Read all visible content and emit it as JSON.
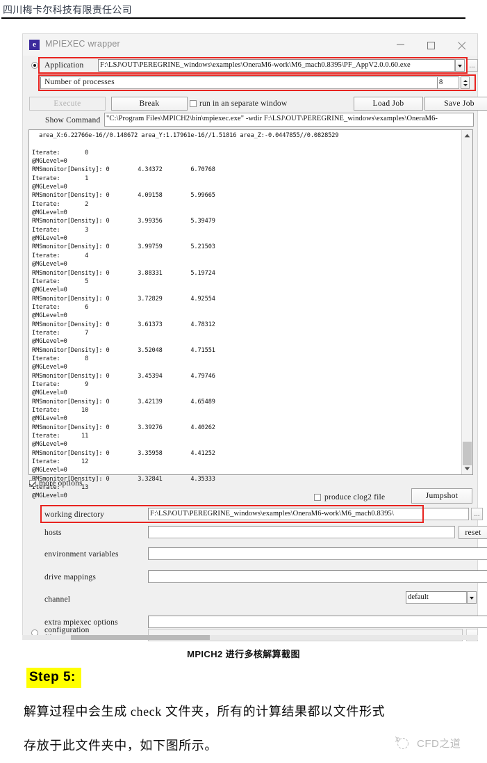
{
  "document": {
    "header_company": "四川梅卡尔科技有限责任公司",
    "caption": "MPICH2 进行多核解算截图",
    "step_badge": "Step 5:",
    "paragraph_line1": "解算过程中会生成 check 文件夹，所有的计算结果都以文件形式",
    "paragraph_line2": "存放于此文件夹中，如下图所示。",
    "watermark_text": "CFD之道"
  },
  "window": {
    "title": "MPIEXEC wrapper",
    "app_icon_glyph": "e",
    "minimize_label": "minimize",
    "maximize_label": "maximize",
    "close_label": "close"
  },
  "application_row": {
    "label": "Application",
    "value": "F:\\LSJ\\OUT\\PEREGRINE_windows\\examples\\OneraM6-work\\M6_mach0.8395\\PF_AppV2.0.0.60.exe",
    "browse_label": "...",
    "radio_selected": true
  },
  "processes_row": {
    "label": "Number of processes",
    "value": "8"
  },
  "buttons": {
    "execute": "Execute",
    "execute_disabled": true,
    "break": "Break",
    "run_separate_window_label": "run in an separate window",
    "run_separate_window_checked": false,
    "load_job": "Load Job",
    "save_job": "Save Job"
  },
  "show_command": {
    "label": "Show Command",
    "value": "\"C:\\Program Files\\MPICH2\\bin\\mpiexec.exe\" -wdir F:\\LSJ\\OUT\\PEREGRINE_windows\\examples\\OneraM6-"
  },
  "console": {
    "text": "  area_X:6.22766e-16//0.148672 area_Y:1.17961e-16//1.51816 area_Z:-0.0447855//0.0828529\n\nIterate:       0\n@MGLevel=0\nRMSmonitor[Density]: 0        4.34372        6.70768\nIterate:       1\n@MGLevel=0\nRMSmonitor[Density]: 0        4.09158        5.99665\nIterate:       2\n@MGLevel=0\nRMSmonitor[Density]: 0        3.99356        5.39479\nIterate:       3\n@MGLevel=0\nRMSmonitor[Density]: 0        3.99759        5.21503\nIterate:       4\n@MGLevel=0\nRMSmonitor[Density]: 0        3.88331        5.19724\nIterate:       5\n@MGLevel=0\nRMSmonitor[Density]: 0        3.72829        4.92554\nIterate:       6\n@MGLevel=0\nRMSmonitor[Density]: 0        3.61373        4.78312\nIterate:       7\n@MGLevel=0\nRMSmonitor[Density]: 0        3.52048        4.71551\nIterate:       8\n@MGLevel=0\nRMSmonitor[Density]: 0        3.45394        4.79746\nIterate:       9\n@MGLevel=0\nRMSmonitor[Density]: 0        3.42139        4.65489\nIterate:      10\n@MGLevel=0\nRMSmonitor[Density]: 0        3.39276        4.40262\nIterate:      11\n@MGLevel=0\nRMSmonitor[Density]: 0        3.35958        4.41252\nIterate:      12\n@MGLevel=0\nRMSmonitor[Density]: 0        3.32841        4.35333\nIterate:      13\n@MGLevel=0"
  },
  "more_options": {
    "label": "more options",
    "checked": true
  },
  "clog2": {
    "label": "produce clog2 file",
    "checked": false,
    "jumpshot_label": "Jumpshot"
  },
  "fields": [
    {
      "name": "working-directory",
      "label": "working directory",
      "value": "F:\\LSJ\\OUT\\PEREGRINE_windows\\examples\\OneraM6-work\\M6_mach0.8395\\",
      "trailing": "...",
      "trailing_type": "dots"
    },
    {
      "name": "hosts",
      "label": "hosts",
      "value": "",
      "trailing": "reset",
      "trailing_type": "button"
    },
    {
      "name": "environment-variables",
      "label": "environment variables",
      "value": "",
      "trailing": "",
      "trailing_type": "none"
    },
    {
      "name": "drive-mappings",
      "label": "drive mappings",
      "value": "",
      "trailing": "",
      "trailing_type": "none"
    },
    {
      "name": "channel",
      "label": "channel",
      "value": "default",
      "trailing": "",
      "trailing_type": "combo"
    },
    {
      "name": "extra-mpiexec-options",
      "label": "extra mpiexec options",
      "value": "",
      "trailing": "",
      "trailing_type": "none"
    },
    {
      "name": "configuration",
      "label": "configuration",
      "sublabel": "file",
      "value": "",
      "trailing": "...",
      "trailing_type": "dots"
    }
  ],
  "colors": {
    "annotation_red": "#e8231f",
    "highlight_yellow": "#ffff00",
    "window_chrome": "#f0f0f0",
    "app_icon": "#3b2a9c"
  }
}
